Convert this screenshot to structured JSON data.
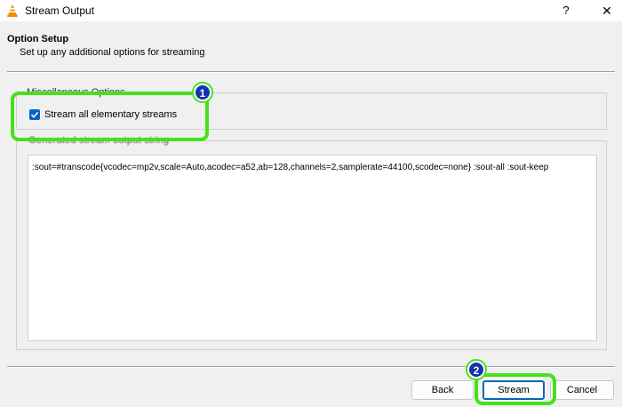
{
  "window": {
    "title": "Stream Output",
    "help_label": "?",
    "close_label": "✕"
  },
  "page": {
    "section_title": "Option Setup",
    "section_subtitle": "Set up any additional options for streaming"
  },
  "misc_options": {
    "legend": "Miscellaneous Options",
    "stream_all_label": "Stream all elementary streams",
    "stream_all_checked": true
  },
  "output_string": {
    "legend": "Generated stream output string",
    "value": ":sout=#transcode{vcodec=mp2v,scale=Auto,acodec=a52,ab=128,channels=2,samplerate=44100,scodec=none} :sout-all :sout-keep"
  },
  "buttons": {
    "back": "Back",
    "stream": "Stream",
    "cancel": "Cancel"
  },
  "annotations": {
    "step1": "1",
    "step2": "2",
    "highlight_color": "#45e21c",
    "badge_color": "#1532b0"
  },
  "colors": {
    "accent": "#0067c0"
  }
}
